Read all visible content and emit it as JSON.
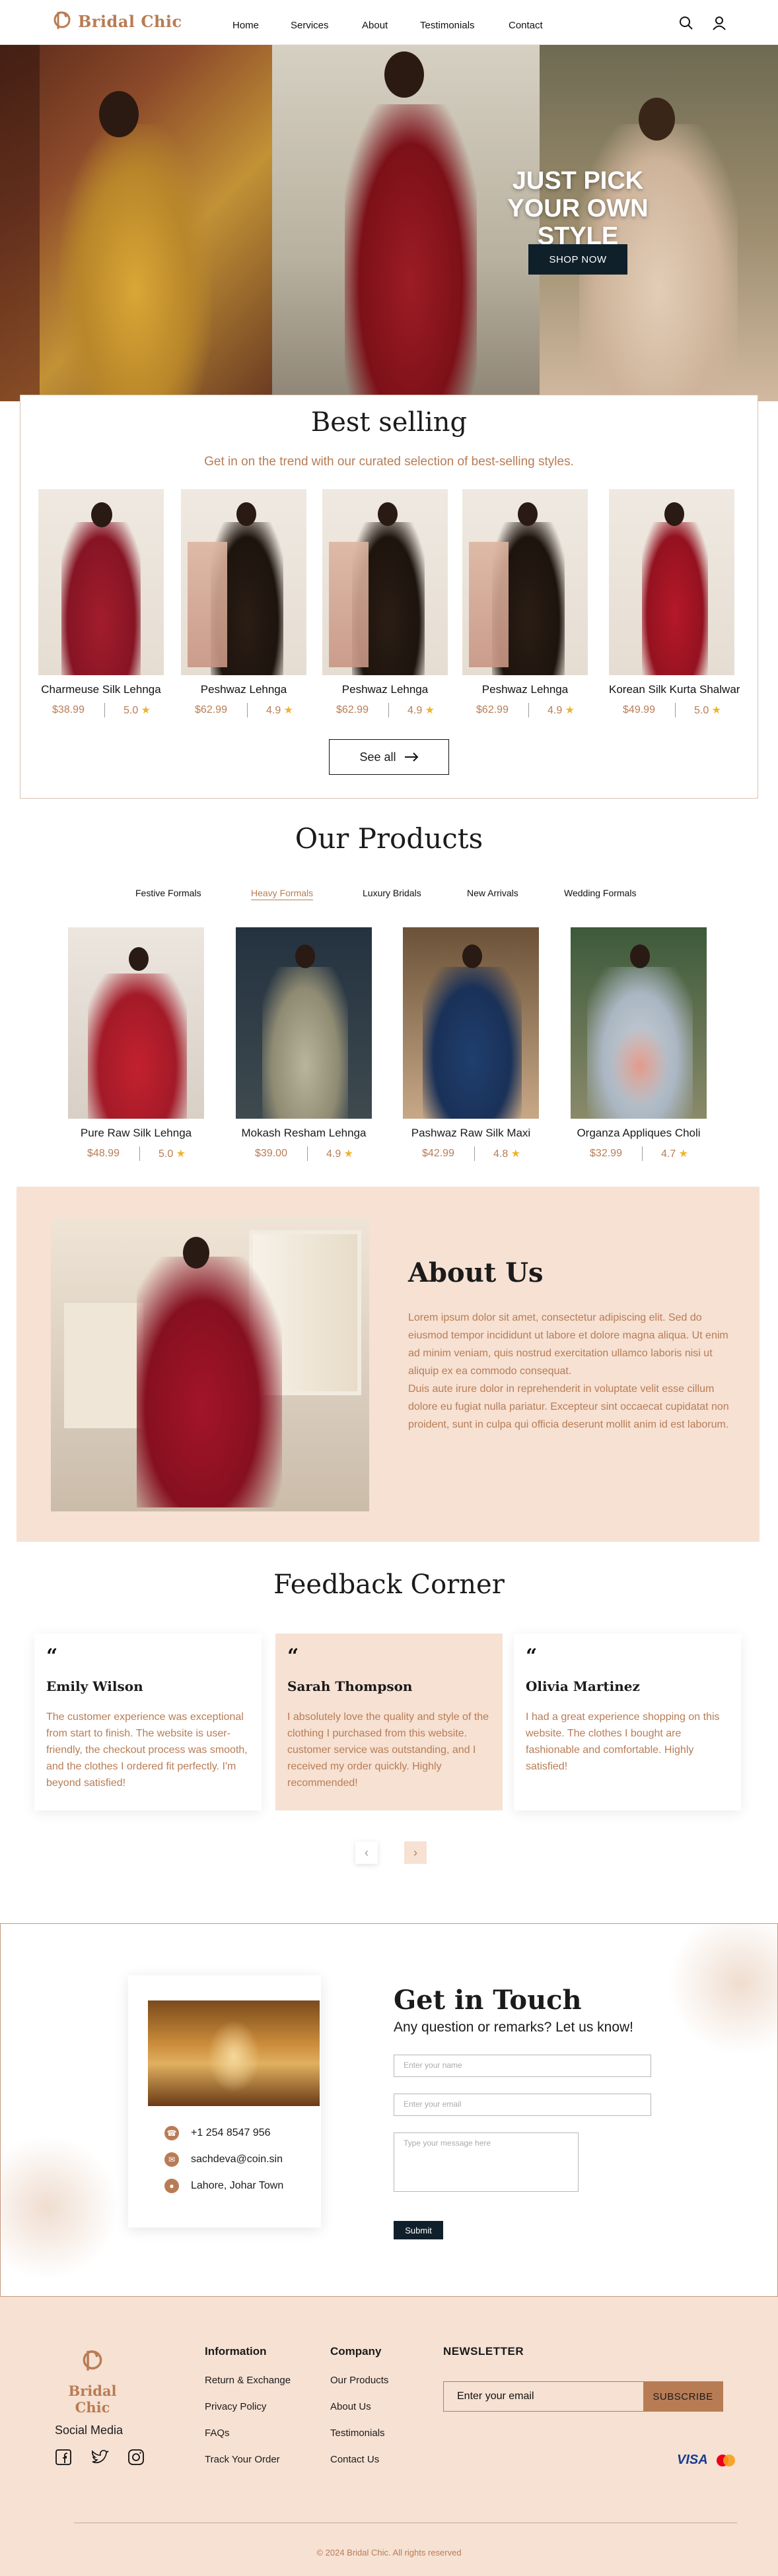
{
  "brand": {
    "name": "Bridal Chic",
    "accent": "#b87c55",
    "dark": "#10202b",
    "blush": "#f6e1d3"
  },
  "nav": {
    "links": [
      "Home",
      "Services",
      "About",
      "Testimonials",
      "Contact"
    ],
    "icons": [
      "search-icon",
      "user-icon"
    ]
  },
  "hero": {
    "title": "JUST PICK YOUR OWN STYLE",
    "button": "SHOP NOW"
  },
  "best_selling": {
    "title": "Best selling",
    "subtitle": "Get in on the trend with our curated selection of best-selling styles.",
    "items": [
      {
        "name": "Charmeuse Silk Lehnga",
        "price": "$38.99",
        "rating": "5.0"
      },
      {
        "name": "Peshwaz Lehnga",
        "price": "$62.99",
        "rating": "4.9"
      },
      {
        "name": "Peshwaz Lehnga",
        "price": "$62.99",
        "rating": "4.9"
      },
      {
        "name": "Peshwaz Lehnga",
        "price": "$62.99",
        "rating": "4.9"
      },
      {
        "name": "Korean Silk Kurta Shalwar",
        "price": "$49.99",
        "rating": "5.0"
      }
    ],
    "see_all": "See all"
  },
  "products": {
    "title": "Our Products",
    "tabs": [
      "Festive Formals",
      "Heavy Formals",
      "Luxury Bridals",
      "New Arrivals",
      "Wedding Formals"
    ],
    "active_tab": "Heavy Formals",
    "items": [
      {
        "name": "Pure Raw Silk Lehnga",
        "price": "$48.99",
        "rating": "5.0"
      },
      {
        "name": "Mokash Resham Lehnga",
        "price": "$39.00",
        "rating": "4.9"
      },
      {
        "name": "Pashwaz Raw Silk Maxi",
        "price": "$42.99",
        "rating": "4.8"
      },
      {
        "name": "Organza Appliques Choli",
        "price": "$32.99",
        "rating": "4.7"
      }
    ]
  },
  "about": {
    "title": "About Us",
    "text": "Lorem ipsum dolor sit amet, consectetur adipiscing elit. Sed do eiusmod tempor incididunt ut labore et dolore magna aliqua. Ut enim ad minim veniam, quis nostrud exercitation ullamco laboris nisi ut aliquip ex ea commodo consequat.\nDuis aute irure dolor in reprehenderit in voluptate velit esse cillum dolore eu fugiat nulla pariatur. Excepteur sint occaecat cupidatat non proident, sunt in culpa qui officia deserunt mollit anim id est laborum."
  },
  "feedback": {
    "title": "Feedback Corner",
    "quote_mark": "“",
    "items": [
      {
        "name": "Emily Wilson",
        "text": "The customer experience was exceptional from start to finish. The website is user-friendly, the checkout process was smooth, and the clothes I ordered fit perfectly. I'm beyond satisfied!"
      },
      {
        "name": "Sarah Thompson",
        "text": "I absolutely love the quality and style of the clothing I purchased from this website. customer service was outstanding, and I received my order quickly. Highly recommended!"
      },
      {
        "name": "Olivia Martinez",
        "text": "I had a great experience shopping on this website. The clothes I bought are fashionable and comfortable. Highly satisfied!"
      }
    ],
    "prev": "‹",
    "next": "›"
  },
  "contact": {
    "phone": "+1 254 8547 956",
    "email": "sachdeva@coin.sin",
    "address": "Lahore, Johar Town",
    "title": "Get in Touch",
    "subtitle": "Any question or remarks? Let us know!",
    "name_placeholder": "Enter your name",
    "email_placeholder": "Enter your email",
    "message_placeholder": "Type your message here",
    "submit": "Submit"
  },
  "footer": {
    "social_title": "Social Media",
    "information": {
      "title": "Information",
      "links": [
        "Return & Exchange",
        "Privacy Policy",
        "FAQs",
        "Track Your Order"
      ]
    },
    "company": {
      "title": "Company",
      "links": [
        "Our Products",
        "About Us",
        "Testimonials",
        "Contact Us"
      ]
    },
    "newsletter": {
      "title": "NEWSLETTER",
      "placeholder": "Enter your email",
      "button": "SUBSCRIBE"
    },
    "payments": [
      "VISA"
    ],
    "copyright": "© 2024 Bridal Chic. All rights reserved"
  }
}
